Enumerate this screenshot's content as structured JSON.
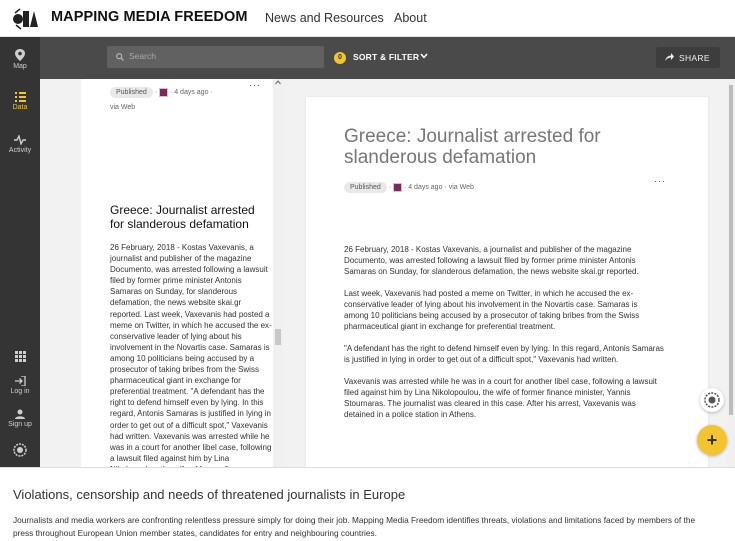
{
  "header": {
    "brand": "MAPPING MEDIA FREEDOM",
    "nav": [
      "News and Resources",
      "About"
    ]
  },
  "sidebar": {
    "items": [
      {
        "label": "Map",
        "icon": "map-pin-icon"
      },
      {
        "label": "Data",
        "icon": "data-list-icon",
        "active": true
      },
      {
        "label": "Activity",
        "icon": "activity-icon"
      },
      {
        "label": "",
        "icon": "grid-icon"
      },
      {
        "label": "Log in",
        "icon": "login-icon"
      },
      {
        "label": "Sign up",
        "icon": "user-icon"
      },
      {
        "label": "",
        "icon": "badge-icon"
      }
    ]
  },
  "toolbar": {
    "search_placeholder": "Search",
    "filter_count": "0",
    "filter_label": "SORT & FILTER",
    "share_label": "SHARE"
  },
  "left_card": {
    "status": "Published",
    "time": "4 days ago",
    "via": "via Web",
    "title": "Greece: Journalist arrested for slanderous defamation",
    "body": "26 February, 2018 - Kostas Vaxevanis, a journalist and publisher of the magazine Documento, was arrested following a lawsuit filed by former prime minister Antonis Samaras on Sunday, for slanderous defamation, the news website skai.gr reported. Last week, Vaxevanis had posted a meme on Twitter, in which he accused the ex-conservative leader of lying about his involvement in the Novartis case. Samaras is among 10 politicians being accused by a prosecutor of taking bribes from the Swiss pharmaceutical giant in exchange for preferential treatment. \"A defendant has the right to defend himself even by lying. In this regard, Antonis Samaras is justified in lying in order to get out of a difficult spot,\" Vaxevanis had written. Vaxevanis was arrested while he was in a court for another libel case, following a lawsuit filed against him by Lina Nikolopoulou, the wife of former finance minister, Yannis Stournaras. The journalist was cleared in this case. After his arrest,"
  },
  "right_card": {
    "title": "Greece: Journalist arrested for slanderous defamation",
    "status": "Published",
    "time": "4 days ago",
    "via": "via Web",
    "paragraphs": [
      "26 February, 2018 - Kostas Vaxevanis, a journalist and publisher of the magazine Documento, was arrested following a lawsuit filed by former prime minister Antonis Samaras on Sunday, for slanderous defamation, the news website skai.gr reported.",
      "Last week, Vaxevanis had posted a meme on Twitter, in which he accused the ex-conservative leader of lying about his involvement in the Novartis case. Samaras is among 10 politicians being accused by a prosecutor of taking bribes from the Swiss pharmaceutical giant in exchange for preferential treatment.",
      "\"A defendant has the right to defend himself even by lying. In this regard, Antonis Samaras is justified in lying in order to get out of a difficult spot,\" Vaxevanis had written.",
      "Vaxevanis was arrested while he was in a court for another libel case, following a lawsuit filed against him by Lina Nikolopoulou, the wife of former finance minister, Yannis Stournaras. The journalist was cleared in this case. After his arrest, Vaxevanis was detained in a police station in Athens."
    ]
  },
  "fab_label": "+",
  "footer": {
    "title": "Violations, censorship and needs of threatened journalists in Europe",
    "text": "Journalists and media workers are confronting relentless pressure simply for doing their job. Mapping Media Freedom identifies threats, violations and limitations faced by members of the press throughout European Union member states, candidates for entry and neighbouring countries."
  },
  "colors": {
    "accent": "#f4c42f",
    "sidebar": "#343434",
    "toolbar": "#4a4a4a"
  }
}
